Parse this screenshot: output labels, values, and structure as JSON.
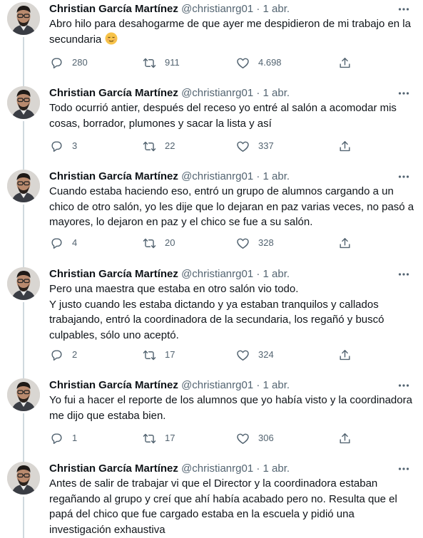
{
  "tweets": [
    {
      "name": "Christian García Martínez",
      "handle": "@christianrg01",
      "dot": "·",
      "date": "1 abr.",
      "text": "Abro hilo para desahogarme de que ayer me despidieron de mi trabajo en la secundaria",
      "emoji": "relieved-face-emoji",
      "replies": "280",
      "retweets": "911",
      "likes": "4.698"
    },
    {
      "name": "Christian García Martínez",
      "handle": "@christianrg01",
      "dot": "·",
      "date": "1 abr.",
      "text": "Todo ocurrió antier, después del receso yo entré al salón a acomodar mis cosas, borrador, plumones y sacar la lista y así",
      "replies": "3",
      "retweets": "22",
      "likes": "337"
    },
    {
      "name": "Christian García Martínez",
      "handle": "@christianrg01",
      "dot": "·",
      "date": "1 abr.",
      "text": "Cuando estaba haciendo eso, entró un grupo de alumnos cargando a un chico de otro salón, yo les dije que lo dejaran en paz varias veces, no pasó a mayores, lo dejaron en paz y el chico se fue a su salón.",
      "replies": "4",
      "retweets": "20",
      "likes": "328"
    },
    {
      "name": "Christian García Martínez",
      "handle": "@christianrg01",
      "dot": "·",
      "date": "1 abr.",
      "text": "Pero una maestra que estaba en otro salón vio todo.\nY justo cuando les estaba dictando y ya estaban tranquilos y callados trabajando, entró la coordinadora de la secundaria, los regañó y buscó culpables, sólo uno aceptó.",
      "replies": "2",
      "retweets": "17",
      "likes": "324"
    },
    {
      "name": "Christian García Martínez",
      "handle": "@christianrg01",
      "dot": "·",
      "date": "1 abr.",
      "text": "Yo fui a hacer el reporte de los alumnos que yo había visto y la coordinadora me dijo que estaba bien.",
      "replies": "1",
      "retweets": "17",
      "likes": "306"
    },
    {
      "name": "Christian García Martínez",
      "handle": "@christianrg01",
      "dot": "·",
      "date": "1 abr.",
      "text": "Antes de salir de trabajar vi que el Director y la coordinadora estaban regañando al grupo y creí que ahí había acabado pero no. Resulta que el papá del chico que fue cargado estaba en la escuela y pidió una investigación exhaustiva",
      "replies": "",
      "retweets": "",
      "likes": ""
    }
  ],
  "icons": {
    "reply": "reply-icon",
    "retweet": "retweet-icon",
    "like": "like-icon",
    "share": "share-icon",
    "more": "more-options-icon"
  },
  "colors": {
    "text": "#0f1419",
    "secondary": "#536471",
    "thread_line": "#cfd9de"
  }
}
